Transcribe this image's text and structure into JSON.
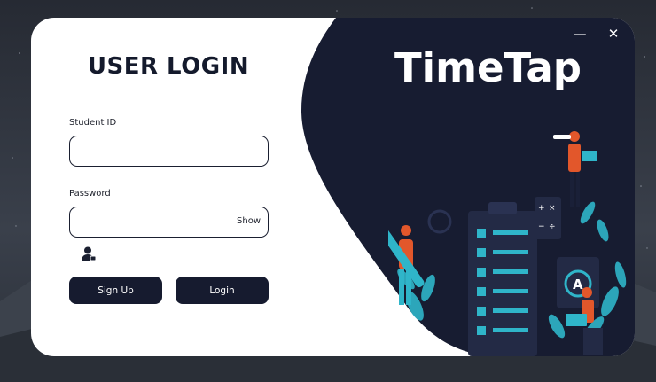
{
  "login_form": {
    "heading": "USER LOGIN",
    "student_id_label": "Student ID",
    "student_id_value": "",
    "password_label": "Password",
    "password_value": "",
    "show_toggle": "Show",
    "signup_label": "Sign Up",
    "login_label": "Login"
  },
  "brand": {
    "name": "TimeTap"
  },
  "window_controls": {
    "minimize": "—",
    "close": "✕"
  },
  "icons": {
    "user": "user-icon",
    "minimize": "minimize-icon",
    "close": "close-icon"
  },
  "colors": {
    "panel": "#171c31",
    "accent": "#2fb5c9",
    "button": "#161b2f",
    "highlight": "#e2572b"
  }
}
